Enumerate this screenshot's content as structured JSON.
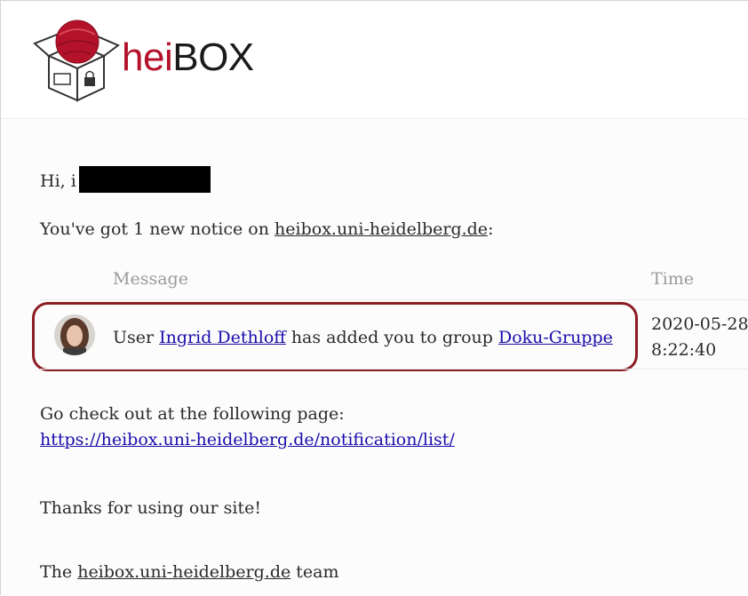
{
  "header": {
    "brand_hei": "hei",
    "brand_box": "BOX"
  },
  "email": {
    "greeting": "Hi, i",
    "intro_prefix": "You've got 1 new notice on ",
    "intro_link": "heibox.uni-heidelberg.de",
    "intro_suffix": ":",
    "table": {
      "col_message": "Message",
      "col_time": "Time",
      "row": {
        "prefix": "User ",
        "user_link": "Ingrid Dethloff",
        "middle": " has added you to group ",
        "group_link": "Doku-Gruppe",
        "date": "2020-05-28",
        "time": "8:22:40"
      }
    },
    "check_text": "Go check out at the following page:",
    "check_link": "https://heibox.uni-heidelberg.de/notification/list/",
    "thanks": "Thanks for using our site!",
    "team_prefix": "The ",
    "team_link": "heibox.uni-heidelberg.de",
    "team_suffix": " team"
  },
  "colors": {
    "brand_red": "#b3122a",
    "link_blue": "#1a0dab",
    "highlight_border": "#8c1c24"
  }
}
